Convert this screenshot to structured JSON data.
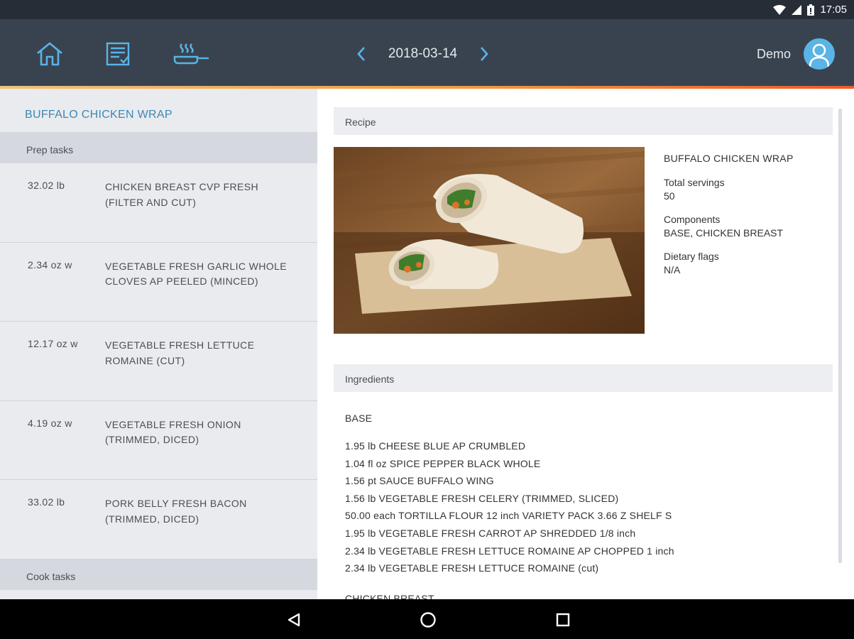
{
  "status_bar": {
    "time": "17:05"
  },
  "header": {
    "date": "2018-03-14",
    "user_name": "Demo",
    "icons": [
      "home-icon",
      "checklist-icon",
      "cooking-pan-icon"
    ]
  },
  "left_panel": {
    "title": "BUFFALO CHICKEN WRAP",
    "prep_heading": "Prep tasks",
    "prep_tasks": [
      {
        "qty": "32.02 lb",
        "desc": "CHICKEN BREAST CVP FRESH (FILTER AND CUT)"
      },
      {
        "qty": "2.34 oz w",
        "desc": "VEGETABLE FRESH GARLIC WHOLE CLOVES AP PEELED (MINCED)"
      },
      {
        "qty": "12.17 oz w",
        "desc": "VEGETABLE FRESH LETTUCE ROMAINE (CUT)"
      },
      {
        "qty": "4.19 oz w",
        "desc": "VEGETABLE FRESH ONION (TRIMMED, DICED)"
      },
      {
        "qty": "33.02 lb",
        "desc": "PORK BELLY FRESH BACON (TRIMMED, DICED)"
      }
    ],
    "cook_heading": "Cook tasks"
  },
  "recipe": {
    "heading": "Recipe",
    "name": "BUFFALO CHICKEN WRAP",
    "servings_label": "Total servings",
    "servings_value": "50",
    "components_label": "Components",
    "components_value": "BASE, CHICKEN BREAST",
    "dietary_label": "Dietary flags",
    "dietary_value": "N/A"
  },
  "ingredients": {
    "heading": "Ingredients",
    "groups": [
      {
        "name": "BASE",
        "items": [
          "1.95 lb CHEESE BLUE AP CRUMBLED",
          "1.04 fl oz SPICE PEPPER BLACK WHOLE",
          "1.56 pt SAUCE BUFFALO WING",
          "1.56 lb VEGETABLE FRESH CELERY (TRIMMED, SLICED)",
          "50.00 each TORTILLA FLOUR 12 inch VARIETY PACK 3.66 Z SHELF S",
          "1.95 lb VEGETABLE FRESH CARROT AP SHREDDED 1/8 inch",
          "2.34 lb VEGETABLE FRESH LETTUCE ROMAINE AP CHOPPED 1 inch",
          "2.34 lb VEGETABLE FRESH LETTUCE ROMAINE (cut)"
        ]
      },
      {
        "name": "CHICKEN BREAST",
        "items": []
      }
    ]
  },
  "colors": {
    "header_bg": "#39434f",
    "status_bg": "#262d36",
    "accent_blue": "#5ab4e6",
    "title_blue": "#3d87b6",
    "accent_orange": "#f39a3e"
  }
}
